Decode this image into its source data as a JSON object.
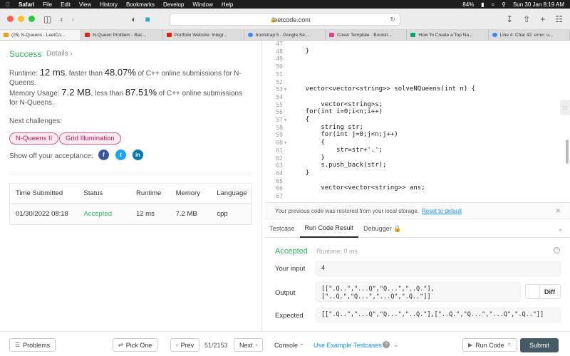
{
  "menubar": {
    "items": [
      "Safari",
      "File",
      "Edit",
      "View",
      "History",
      "Bookmarks",
      "Develop",
      "Window",
      "Help"
    ],
    "battery": "84%",
    "datetime": "Sun 30 Jan  8:19 AM"
  },
  "browser": {
    "url": "leetcode.com",
    "tabs": [
      {
        "label": "(25) N-Queens - LeetCo...",
        "color": "#f0a020"
      },
      {
        "label": "N-Queen Problem - Bac...",
        "color": "#e62117"
      },
      {
        "label": "Portfolio Website: Integr...",
        "color": "#e62117"
      },
      {
        "label": "bootstrap 5 - Google Se...",
        "color": "#4285f4"
      },
      {
        "label": "Cover Template · Bootstr...",
        "color": "#e83e8c"
      },
      {
        "label": "How To Create a Top Na...",
        "color": "#04aa6d"
      },
      {
        "label": "Line 4: Char 42: error: u...",
        "color": "#4285f4"
      }
    ]
  },
  "submission": {
    "status": "Success",
    "details_label": "Details",
    "runtime_prefix": "Runtime:",
    "runtime_value": "12 ms",
    "runtime_mid": ", faster than",
    "runtime_pct": "48.07%",
    "runtime_suffix": "of C++ online submissions for N-Queens.",
    "memory_prefix": "Memory Usage:",
    "memory_value": "7.2 MB",
    "memory_mid": ", less than",
    "memory_pct": "87.51%",
    "memory_suffix": "of C++ online submissions for N-Queens.",
    "next_label": "Next challenges:",
    "challenges": [
      "N-Queens II",
      "Grid Illumination"
    ],
    "showoff_label": "Show off your acceptance:",
    "table": {
      "headers": [
        "Time Submitted",
        "Status",
        "Runtime",
        "Memory",
        "Language"
      ],
      "row": [
        "01/30/2022 08:18",
        "Accepted",
        "12 ms",
        "7.2 MB",
        "cpp"
      ]
    }
  },
  "editor": {
    "line_numbers": [
      "47",
      "48",
      "49",
      "50",
      "51",
      "52",
      "53",
      "54",
      "55",
      "56",
      "57",
      "58",
      "59",
      "60",
      "61",
      "62",
      "63",
      "64",
      "65",
      "66",
      "67"
    ],
    "lines": [
      "",
      "    }",
      "",
      "",
      "",
      "",
      "    vector<vector<string>> solveNQueens(int n) {",
      "",
      "        vector<string>s;",
      "    for(int i=0;i<n;i++)",
      "    {",
      "        string str;",
      "        for(int j=0;j<n;j++)",
      "        {",
      "            str=str+'.';",
      "        }",
      "        s.push_back(str);",
      "    }",
      "",
      "        vector<vector<string>> ans;",
      ""
    ]
  },
  "notice": {
    "text": "Your previous code was restored from your local storage.",
    "reset": "Reset to default"
  },
  "result_tabs": [
    "Testcase",
    "Run Code Result",
    "Debugger"
  ],
  "result": {
    "status": "Accepted",
    "runtime": "Runtime: 0 ms",
    "input_label": "Your input",
    "input": "4",
    "output_label": "Output",
    "output": "[[\".Q..\",\"...Q\",\"Q...\",\"..Q.\"],\n[\"..Q.\",\"Q...\",\"...Q\",\".Q..\"]]",
    "diff_label": "Diff",
    "expected_label": "Expected",
    "expected": "[[\".Q..\",\"...Q\",\"Q...\",\"..Q.\"],[\"..Q.\",\"Q...\",\"...Q\",\".Q..\"]]"
  },
  "bottom": {
    "problems": "Problems",
    "pick_one": "Pick One",
    "prev": "Prev",
    "pager": "51/2153",
    "next": "Next",
    "console": "Console",
    "example": "Use Example Testcases",
    "run_code": "Run Code",
    "submit": "Submit"
  }
}
